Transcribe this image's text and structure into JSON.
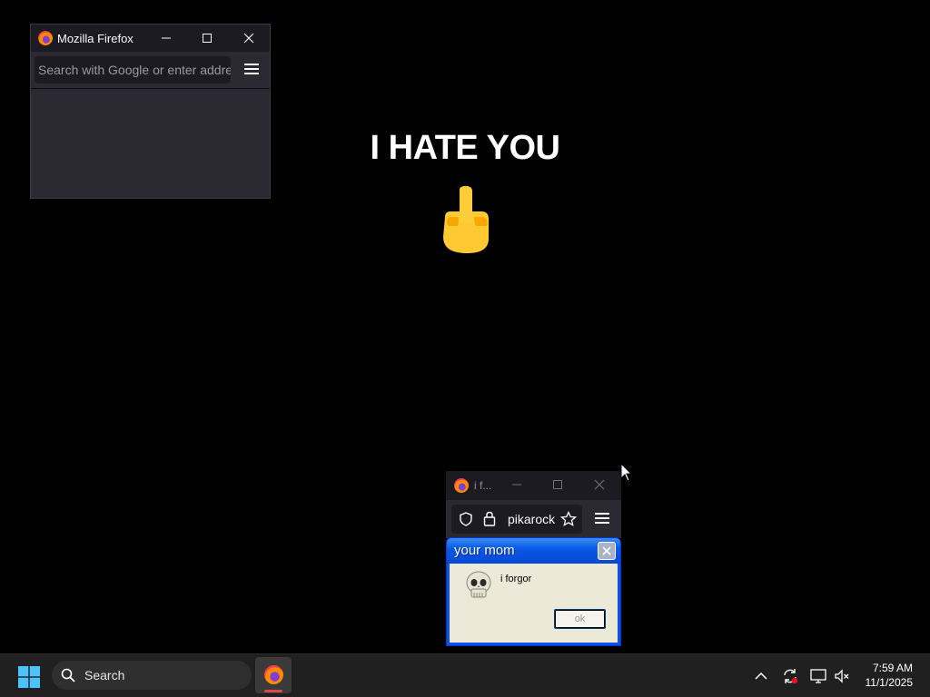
{
  "desktop": {
    "headline": "I HATE YOU",
    "emoji_icon": "middle-finger-icon"
  },
  "firefox_window_main": {
    "title": "Mozilla Firefox",
    "urlbar_placeholder": "Search with Google or enter address",
    "icons": [
      "firefox-logo-icon",
      "minimize-icon",
      "maximize-icon",
      "close-icon",
      "hamburger-menu-icon"
    ]
  },
  "firefox_window_small": {
    "title": "i f...",
    "url": "pikarock:",
    "icons": [
      "firefox-logo-icon",
      "minimize-icon",
      "maximize-icon",
      "close-icon",
      "shield-icon",
      "lock-icon",
      "star-icon",
      "hamburger-menu-icon"
    ]
  },
  "dialog": {
    "title": "your mom",
    "message": "i forgor",
    "ok_label": "ok",
    "icons": [
      "skull-icon",
      "close-icon"
    ]
  },
  "taskbar": {
    "search_label": "Search",
    "time": "7:59 AM",
    "date": "11/1/2025",
    "icons": [
      "windows-start-icon",
      "search-icon",
      "firefox-taskbar-icon",
      "chevron-up-icon",
      "sync-icon",
      "network-icon",
      "volume-muted-icon"
    ]
  },
  "colors": {
    "desktop_bg": "#000000",
    "firefox_chrome": "#2b2a33",
    "xp_title_blue": "#0a5ae6",
    "xp_body": "#ece9d8",
    "taskbar_bg": "#202020"
  }
}
